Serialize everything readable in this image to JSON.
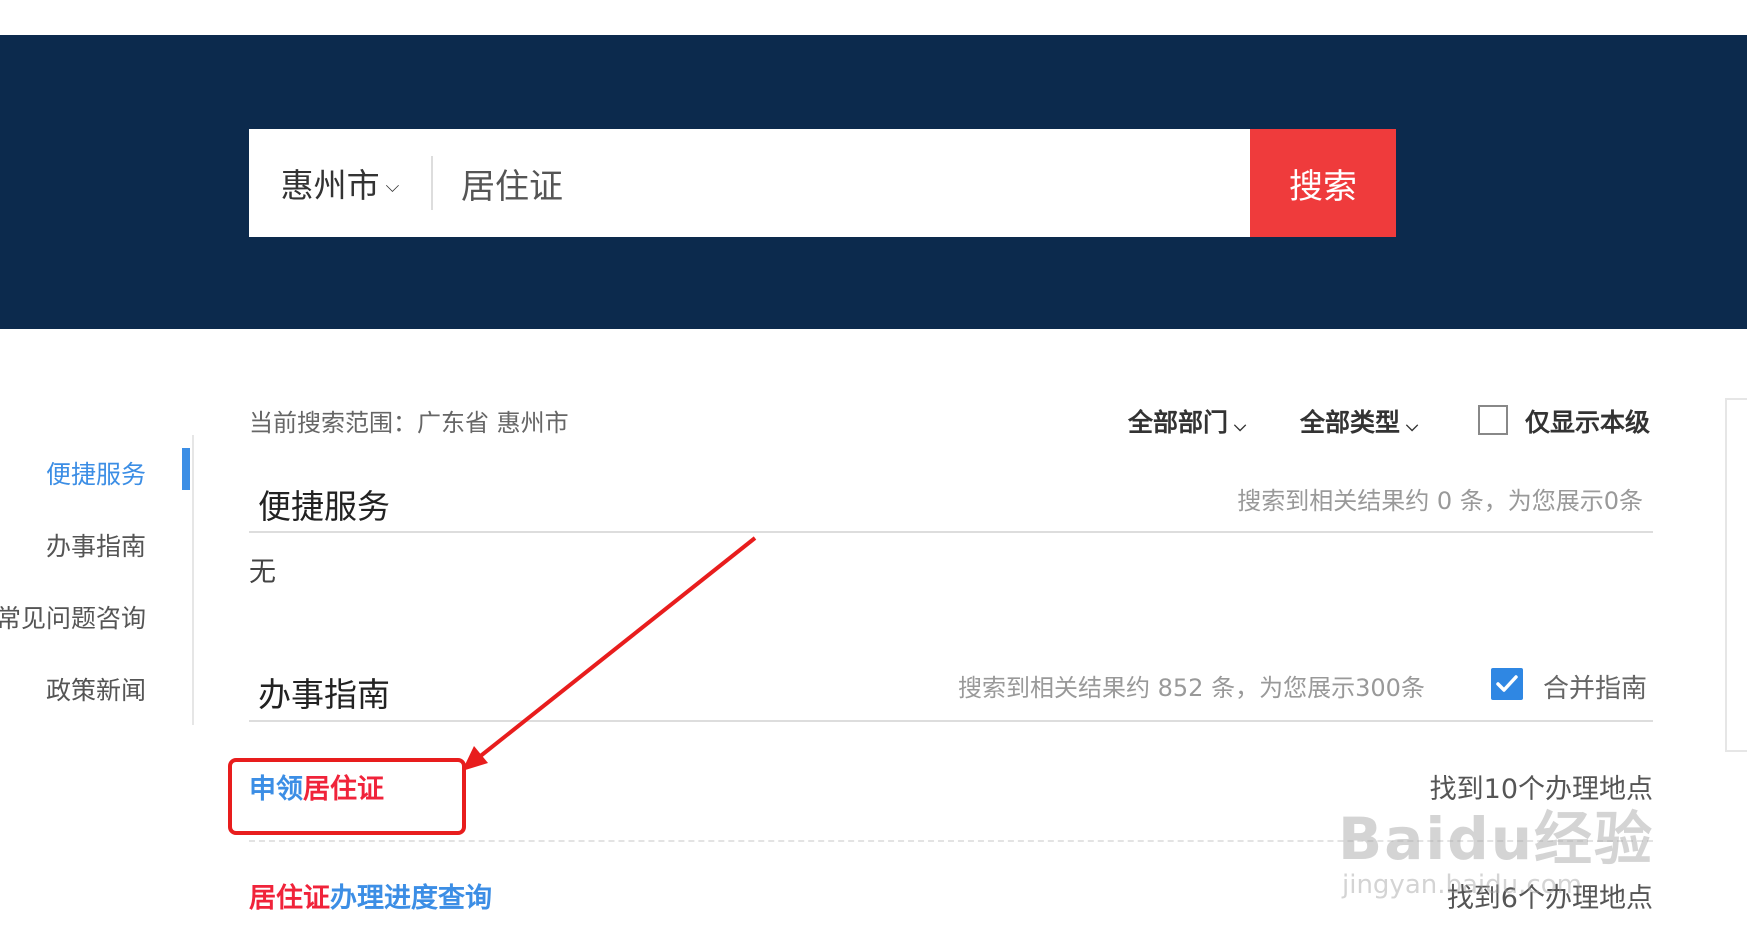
{
  "search": {
    "city": "惠州市",
    "query": "居住证",
    "button_label": "搜索"
  },
  "sidebar": {
    "items": [
      {
        "label": "便捷服务",
        "active": true
      },
      {
        "label": "办事指南",
        "active": false
      },
      {
        "label": "常见问题咨询",
        "active": false
      },
      {
        "label": "政策新闻",
        "active": false
      }
    ]
  },
  "filters": {
    "scope": "当前搜索范围：广东省 惠州市",
    "department": "全部部门",
    "type": "全部类型",
    "only_this_level": "仅显示本级",
    "only_this_level_checked": false
  },
  "sections": {
    "convenient": {
      "title": "便捷服务",
      "stat": "搜索到相关结果约 0 条，为您展示0条",
      "empty_text": "无"
    },
    "guide": {
      "title": "办事指南",
      "stat": "搜索到相关结果约 852 条，为您展示300条",
      "merge_label": "合并指南",
      "merge_checked": true
    }
  },
  "results": [
    {
      "parts": [
        "申领",
        "居住证"
      ],
      "found": "找到10个办理地点"
    },
    {
      "parts": [
        "居住证",
        "办理进度查询"
      ],
      "found": "找到6个办理地点"
    }
  ],
  "watermark": {
    "brand": "Baidu经验",
    "url": "jingyan.baidu.com"
  },
  "colors": {
    "header_bg": "#0c2a4d",
    "search_button": "#ef3b3c",
    "accent_blue": "#3c8ee5",
    "highlight_red": "#f0233a",
    "annotation": "#e81d1d"
  }
}
